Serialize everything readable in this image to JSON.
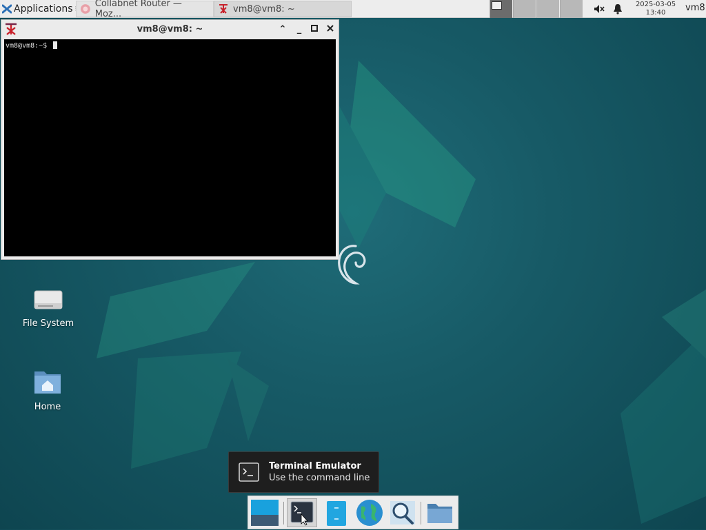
{
  "top_panel": {
    "apps_menu_label": "Applications",
    "tasks": [
      {
        "label": "Collabnet Router — Moz...",
        "icon": "firefox-icon"
      },
      {
        "label": "vm8@vm8: ~",
        "icon": "terminal-app-icon"
      }
    ],
    "clock_date": "2025-03-05",
    "clock_time": "13:40",
    "user": "vm8",
    "tray_icons": [
      "mute-icon",
      "bell-icon"
    ]
  },
  "terminal": {
    "title": "vm8@vm8: ~",
    "prompt": "vm8@vm8:~$"
  },
  "desktop": {
    "icons": [
      {
        "label": "File System",
        "icon": "drive-icon"
      },
      {
        "label": "Home",
        "icon": "home-folder-icon"
      }
    ]
  },
  "tooltip": {
    "title": "Terminal Emulator",
    "subtitle": "Use the command line"
  },
  "dock": {
    "items": [
      "show-desktop-icon",
      "terminal-icon",
      "file-manager-icon",
      "web-browser-icon",
      "search-icon",
      "folder-icon"
    ]
  },
  "colors": {
    "desktop_bg": "#175a66",
    "panel_bg": "#ededed",
    "terminal_bg": "#000000",
    "tooltip_bg": "#1e1e1e"
  }
}
